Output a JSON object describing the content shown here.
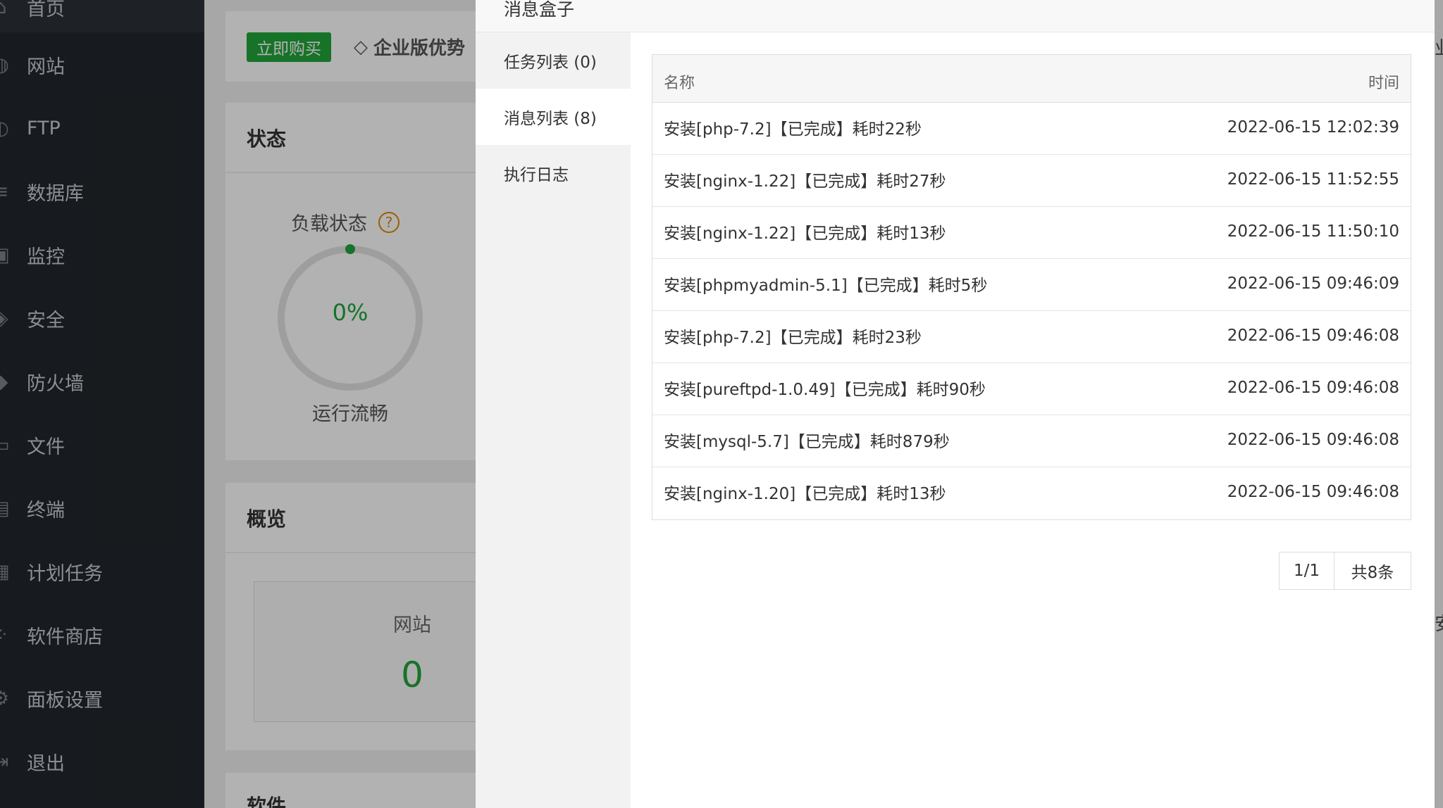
{
  "sidebar": {
    "items": [
      {
        "label": "首页",
        "icon": "home-icon"
      },
      {
        "label": "网站",
        "icon": "globe-icon"
      },
      {
        "label": "FTP",
        "icon": "ftp-icon"
      },
      {
        "label": "数据库",
        "icon": "database-icon"
      },
      {
        "label": "监控",
        "icon": "monitor-icon"
      },
      {
        "label": "安全",
        "icon": "shield-icon"
      },
      {
        "label": "防火墙",
        "icon": "firewall-icon"
      },
      {
        "label": "文件",
        "icon": "folder-icon"
      },
      {
        "label": "终端",
        "icon": "terminal-icon"
      },
      {
        "label": "计划任务",
        "icon": "calendar-icon"
      },
      {
        "label": "软件商店",
        "icon": "store-icon"
      },
      {
        "label": "面板设置",
        "icon": "gear-icon"
      },
      {
        "label": "退出",
        "icon": "logout-icon"
      }
    ]
  },
  "background": {
    "buy_label": "立即购买",
    "enterprise_label": "企业版优势",
    "status_title": "状态",
    "load_label": "负载状态",
    "help_mark": "?",
    "load_value": "0%",
    "load_percent": 0,
    "load_status": "运行流畅",
    "overview_title": "概览",
    "site_label": "网站",
    "site_count": "0",
    "software_title": "软件",
    "edge_text_1": "业",
    "edge_text_2": "安"
  },
  "modal": {
    "title": "消息盒子",
    "nav": [
      {
        "label": "任务列表 (0)"
      },
      {
        "label": "消息列表 (8)"
      },
      {
        "label": "执行日志"
      }
    ],
    "table": {
      "headers": {
        "name": "名称",
        "time": "时间"
      },
      "rows": [
        {
          "name": "安装[php-7.2]【已完成】耗时22秒",
          "time": "2022-06-15 12:02:39"
        },
        {
          "name": "安装[nginx-1.22]【已完成】耗时27秒",
          "time": "2022-06-15 11:52:55"
        },
        {
          "name": "安装[nginx-1.22]【已完成】耗时13秒",
          "time": "2022-06-15 11:50:10"
        },
        {
          "name": "安装[phpmyadmin-5.1]【已完成】耗时5秒",
          "time": "2022-06-15 09:46:09"
        },
        {
          "name": "安装[php-7.2]【已完成】耗时23秒",
          "time": "2022-06-15 09:46:08"
        },
        {
          "name": "安装[pureftpd-1.0.49]【已完成】耗时90秒",
          "time": "2022-06-15 09:46:08"
        },
        {
          "name": "安装[mysql-5.7]【已完成】耗时879秒",
          "time": "2022-06-15 09:46:08"
        },
        {
          "name": "安装[nginx-1.20]【已完成】耗时13秒",
          "time": "2022-06-15 09:46:08"
        }
      ]
    },
    "pager": {
      "page": "1/1",
      "total": "共8条"
    }
  },
  "colors": {
    "accent": "#20a53a",
    "sidebar_bg": "#22262b",
    "warn": "#e08800"
  }
}
